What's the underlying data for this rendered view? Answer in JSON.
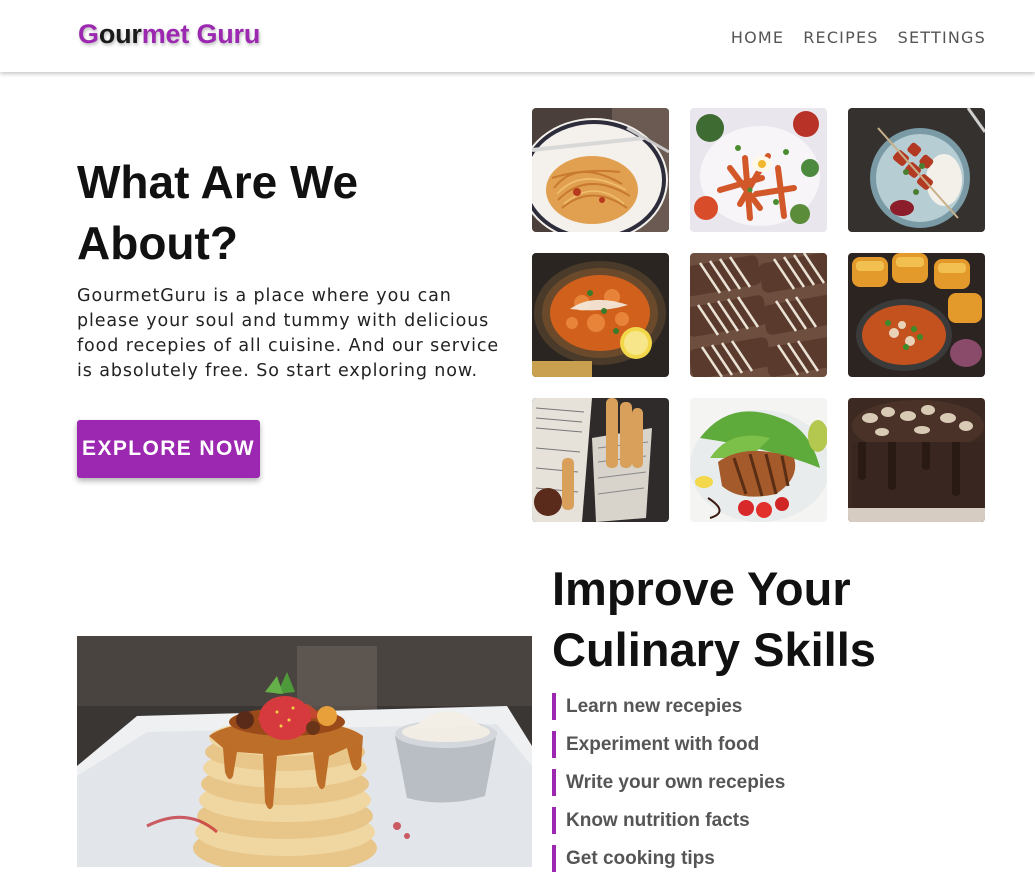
{
  "brand": {
    "part1": "G",
    "part2": "our",
    "part3": "met",
    "part4": " Guru",
    "accent_color": "#9c27b0"
  },
  "nav": {
    "items": [
      "HOME",
      "RECIPES",
      "SETTINGS"
    ]
  },
  "about": {
    "title": "What Are We About?",
    "text": "GourmetGuru is a place where you can please your soul and tummy with delicious food recepies of all cuisine. And our service is absolutely free. So start exploring now.",
    "button_label": "EXPLORE NOW"
  },
  "gallery": {
    "images": [
      {
        "name": "spaghetti-plate-photo"
      },
      {
        "name": "sweet-potato-fries-photo"
      },
      {
        "name": "kebab-skewers-photo"
      },
      {
        "name": "curry-bowl-photo"
      },
      {
        "name": "drizzled-bars-photo"
      },
      {
        "name": "pav-bhaji-photo"
      },
      {
        "name": "churros-photo"
      },
      {
        "name": "grilled-salmon-photo"
      },
      {
        "name": "chocolate-cake-photo"
      }
    ]
  },
  "skills": {
    "title": "Improve Your Culinary Skills",
    "items": [
      "Learn new recepies",
      "Experiment with food",
      "Write your own recepies",
      "Know nutrition facts",
      "Get cooking tips"
    ]
  },
  "hero_image": {
    "name": "pancake-stack-photo"
  }
}
